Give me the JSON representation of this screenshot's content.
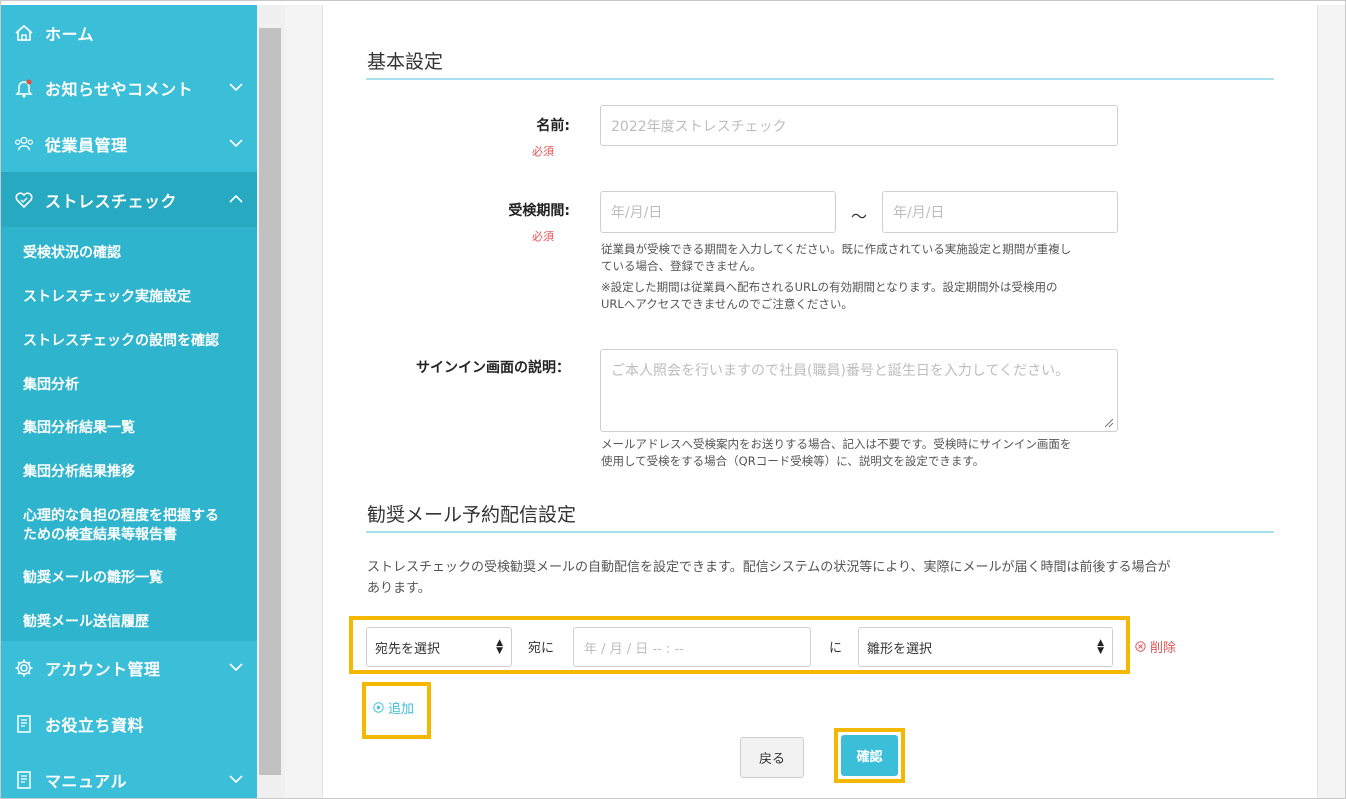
{
  "sidebar": {
    "items": [
      {
        "label": "ホーム",
        "icon": "home-icon"
      },
      {
        "label": "お知らせやコメント",
        "icon": "bell-icon"
      },
      {
        "label": "従業員管理",
        "icon": "users-icon"
      },
      {
        "label": "ストレスチェック",
        "icon": "heart-icon"
      },
      {
        "label": "アカウント管理",
        "icon": "gear-icon"
      },
      {
        "label": "お役立ち資料",
        "icon": "book-icon"
      },
      {
        "label": "マニュアル",
        "icon": "manual-icon"
      }
    ],
    "submenu": [
      "受検状況の確認",
      "ストレスチェック実施設定",
      "ストレスチェックの設問を確認",
      "集団分析",
      "集団分析結果一覧",
      "集団分析結果推移",
      "心理的な負担の程度を把握する",
      "ための検査結果等報告書",
      "勧奨メールの雛形一覧",
      "勧奨メール送信履歴"
    ]
  },
  "basic": {
    "title": "基本設定",
    "name_label": "名前:",
    "required": "必須",
    "name_placeholder": "2022年度ストレスチェック",
    "period_label": "受検期間:",
    "date_placeholder": "年/月/日",
    "tilde": "～",
    "period_help1": "従業員が受検できる期間を入力してください。既に作成されている実施設定と期間が重複し",
    "period_help2": "ている場合、登録できません。",
    "period_help3": "※設定した期間は従業員へ配布されるURLの有効期間となります。設定期間外は受検用の",
    "period_help4": "URLへアクセスできませんのでご注意ください。",
    "signin_label": "サインイン画面の説明：",
    "signin_placeholder": "ご本人照会を行いますので社員(職員)番号と誕生日を入力してください。",
    "signin_help1": "メールアドレスへ受検案内をお送りする場合、記入は不要です。受検時にサインイン画面を",
    "signin_help2": "使用して受検をする場合（QRコード受検等）に、説明文を設定できます。"
  },
  "mail": {
    "title": "勧奨メール予約配信設定",
    "desc1": "ストレスチェックの受検勧奨メールの自動配信を設定できます。配信システムの状況等により、実際にメールが届く時間は前後する場合が",
    "desc2": "あります。",
    "recipient_select": "宛先を選択",
    "to_text": "宛に",
    "datetime_placeholder": "年 / 月 / 日 -- : --",
    "ni_text": "に",
    "template_select": "雛形を選択",
    "delete_label": "削除",
    "add_label": "追加"
  },
  "buttons": {
    "back": "戻る",
    "confirm": "確認"
  },
  "colors": {
    "sidebar": "#3bbfd8",
    "accent": "#3bbfd8",
    "highlight": "#f5b800",
    "required": "#e05555"
  }
}
